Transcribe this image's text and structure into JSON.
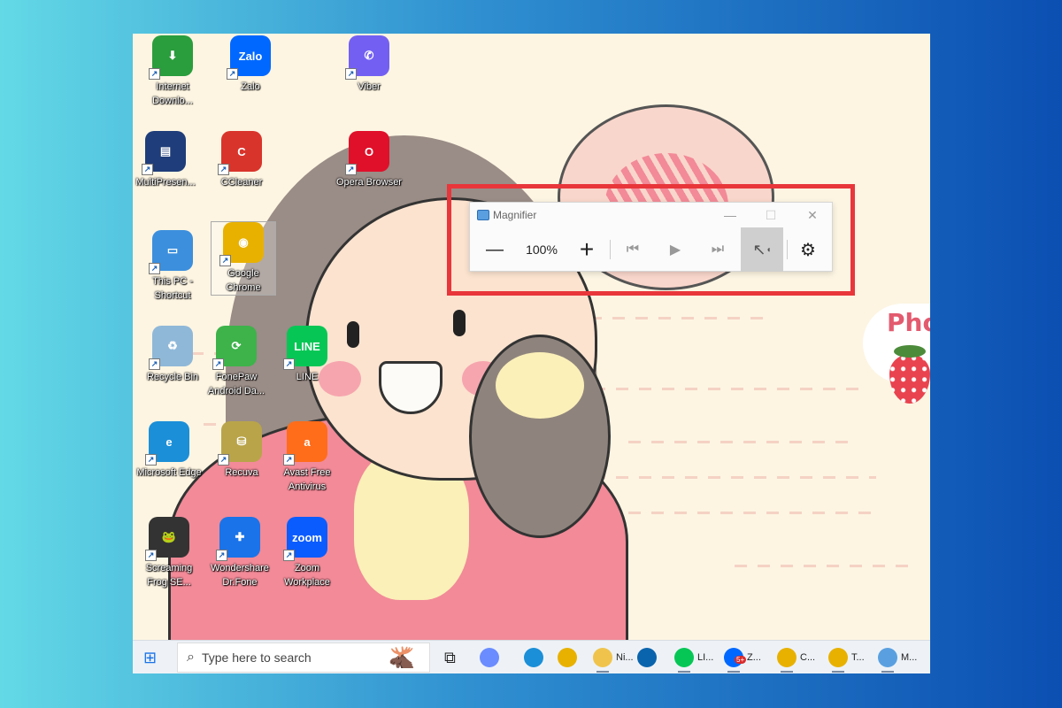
{
  "desktop_icons": [
    {
      "label": "Internet Downlo...",
      "icon": "idm-icon",
      "color": "#2a9d3d",
      "glyph": "⬇"
    },
    {
      "label": "Zalo",
      "icon": "zalo-icon",
      "color": "#0068ff",
      "glyph": "Zalo"
    },
    {
      "label": "Viber",
      "icon": "viber-icon",
      "color": "#7360f2",
      "glyph": "✆"
    },
    {
      "label": "MultiPresen...",
      "icon": "multipresenter-icon",
      "color": "#1f3d7a",
      "glyph": "▤"
    },
    {
      "label": "CCleaner",
      "icon": "ccleaner-icon",
      "color": "#d9342b",
      "glyph": "C"
    },
    {
      "label": "Opera Browser",
      "icon": "opera-icon",
      "color": "#e0102a",
      "glyph": "O"
    },
    {
      "label": "This PC - Shortcut",
      "icon": "this-pc-icon",
      "color": "#3c8fdd",
      "glyph": "▭"
    },
    {
      "label": "Google Chrome",
      "icon": "chrome-icon",
      "color": "#e8b100",
      "glyph": "◉"
    },
    {
      "label": "Recycle Bin",
      "icon": "recycle-bin-icon",
      "color": "#8fb8d8",
      "glyph": "♻"
    },
    {
      "label": "FonePaw Android Da...",
      "icon": "fonepaw-icon",
      "color": "#3db34a",
      "glyph": "⟳"
    },
    {
      "label": "LINE",
      "icon": "line-icon",
      "color": "#06c755",
      "glyph": "LINE"
    },
    {
      "label": "Microsoft Edge",
      "icon": "edge-icon",
      "color": "#1b8fd8",
      "glyph": "e"
    },
    {
      "label": "Recuva",
      "icon": "recuva-icon",
      "color": "#b9a44a",
      "glyph": "⛁"
    },
    {
      "label": "Avast Free Antivirus",
      "icon": "avast-icon",
      "color": "#ff6d1b",
      "glyph": "a"
    },
    {
      "label": "Screaming Frog SE...",
      "icon": "screaming-frog-icon",
      "color": "#333333",
      "glyph": "🐸"
    },
    {
      "label": "Wondershare Dr.Fone",
      "icon": "drfone-icon",
      "color": "#1a73e8",
      "glyph": "✚"
    },
    {
      "label": "Zoom Workplace",
      "icon": "zoom-icon",
      "color": "#0b5cff",
      "glyph": "zoom"
    }
  ],
  "wallpaper": {
    "badge_text": "Pho"
  },
  "magnifier": {
    "title": "Magnifier",
    "minimize": "—",
    "maximize": "☐",
    "close": "✕",
    "zoom_out": "—",
    "zoom_level": "100%",
    "zoom_in": "+",
    "prev": "⏮",
    "play": "▶",
    "next": "⏭",
    "read_from_pointer": "↖",
    "settings": "⚙"
  },
  "taskbar": {
    "start": "⊞",
    "search_placeholder": "Type here to search",
    "task_view": "⧉",
    "apps": [
      {
        "label": "",
        "icon": "copilot-icon",
        "color": "#6b8cff"
      },
      {
        "label": "",
        "icon": "edge-icon",
        "color": "#1b8fd8"
      },
      {
        "label": "",
        "icon": "chrome-icon",
        "color": "#e8b100"
      },
      {
        "label": "Ni...",
        "icon": "folder-icon",
        "color": "#f0c44c"
      },
      {
        "label": "",
        "icon": "outlook-icon",
        "color": "#0a64ad"
      },
      {
        "label": "LI...",
        "icon": "line-icon",
        "color": "#06c755"
      },
      {
        "label": "Z...",
        "icon": "zalo-icon",
        "color": "#0068ff",
        "badge": "5+"
      },
      {
        "label": "C...",
        "icon": "chrome-icon",
        "color": "#e8b100"
      },
      {
        "label": "T...",
        "icon": "chrome-icon",
        "color": "#e8b100"
      },
      {
        "label": "M...",
        "icon": "magnifier-icon",
        "color": "#5aa0e0"
      }
    ]
  },
  "colors": {
    "highlight": "#e8363b",
    "active_tool": "#cfcfcf"
  }
}
